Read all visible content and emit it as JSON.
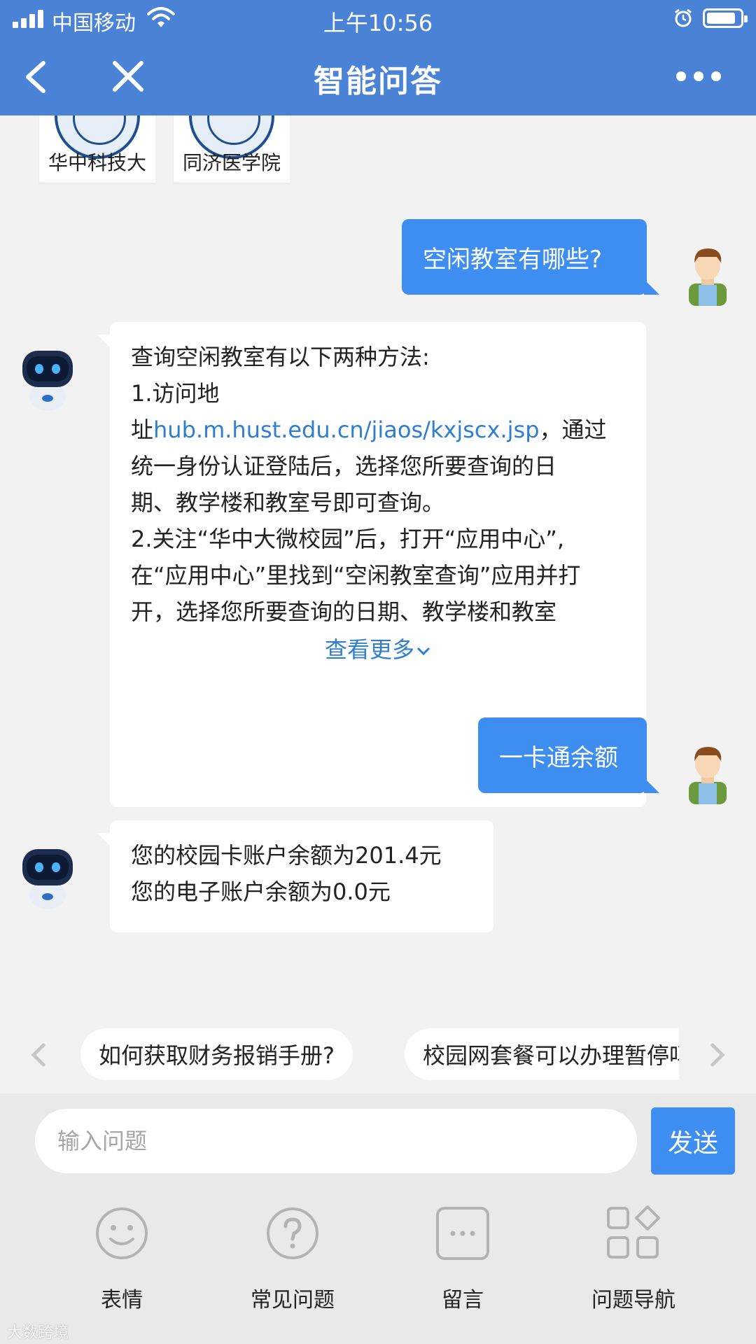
{
  "status_bar": {
    "carrier": "中国移动",
    "time": "上午10:56"
  },
  "nav": {
    "title": "智能问答",
    "back_icon": "chevron-left-icon",
    "close_icon": "close-icon",
    "more_icon": "more-dots-icon"
  },
  "cards": [
    {
      "label": "华中科技大"
    },
    {
      "label": "同济医学院"
    }
  ],
  "messages": {
    "user_1": "空闲教室有哪些?",
    "bot_1": {
      "line1": "查询空闲教室有以下两种方法:",
      "line2": "1.访问地",
      "line3_prefix": "址",
      "link": "hub.m.hust.edu.cn/jiaos/kxjscx.jsp",
      "line3_suffix": "，通过",
      "line4": "统一身份认证登陆后，选择您所要查询的日",
      "line5": "期、教学楼和教室号即可查询。",
      "line6": "2.关注“华中大微校园”后，打开“应用中心”,",
      "line7": "在“应用中心”里找到“空闲教室查询”应用并打",
      "line8": "开，选择您所要查询的日期、教学楼和教室",
      "more": "查看更多"
    },
    "user_2": "一卡通余额",
    "bot_2": {
      "line1": "您的校园卡账户余额为201.4元",
      "line2": "您的电子账户余额为0.0元"
    }
  },
  "suggestions": [
    "如何获取财务报销手册?",
    "校园网套餐可以办理暂停吗?"
  ],
  "input": {
    "placeholder": "输入问题",
    "send_label": "发送"
  },
  "tools": [
    {
      "label": "表情",
      "icon": "smiley-icon"
    },
    {
      "label": "常见问题",
      "icon": "question-icon"
    },
    {
      "label": "留言",
      "icon": "message-icon"
    },
    {
      "label": "问题导航",
      "icon": "grid-nav-icon"
    }
  ],
  "watermark": "大数跨境",
  "colors": {
    "header": "#4a83d6",
    "user_bubble": "#3d8ef0",
    "link": "#2f7fd1"
  }
}
